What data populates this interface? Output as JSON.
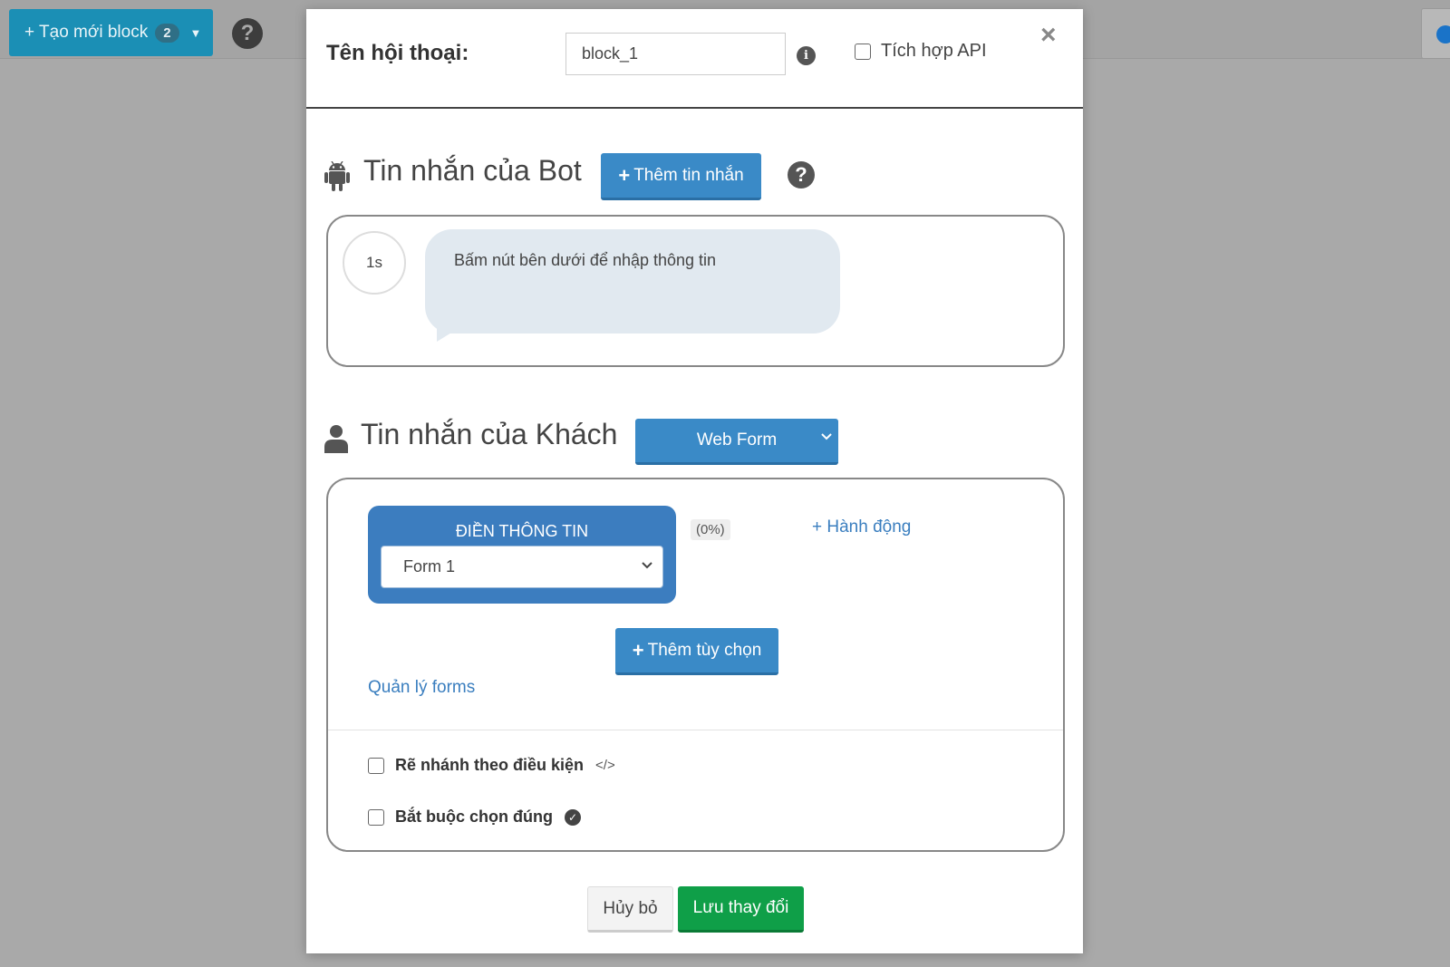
{
  "toolbar": {
    "create_label": "+ Tạo mới block",
    "create_count": "2",
    "help_glyph": "?"
  },
  "colors": {
    "primary_blue": "#3a8ac7",
    "save_green": "#0f9f48",
    "topbar_teal": "#1b8fb5"
  },
  "modal": {
    "conversation_label": "Tên hội thoại:",
    "conversation_value": "block_1",
    "api_label": "Tích hợp API",
    "close_glyph": "×",
    "bot": {
      "title": "Tin nhắn của Bot",
      "icon": "android-icon",
      "add_message_label": "Thêm tin nhắn",
      "delay": "1s",
      "message": "Bấm nút bên dưới để nhập thông tin"
    },
    "guest": {
      "title": "Tin nhắn của Khách",
      "icon": "user-icon",
      "type_selected": "Web Form",
      "form_card_title": "ĐIỀN THÔNG TIN",
      "form_selected": "Form 1",
      "percent": "(0%)",
      "action_link": "+ Hành động",
      "add_option_label": "Thêm tùy chọn",
      "manage_forms_link": "Quản lý forms",
      "branch_label": "Rẽ nhánh theo điều kiện",
      "branch_icon_glyph": "</>",
      "required_label": "Bắt buộc chọn đúng"
    },
    "footer": {
      "cancel_label": "Hủy bỏ",
      "save_label": "Lưu thay đổi"
    }
  }
}
